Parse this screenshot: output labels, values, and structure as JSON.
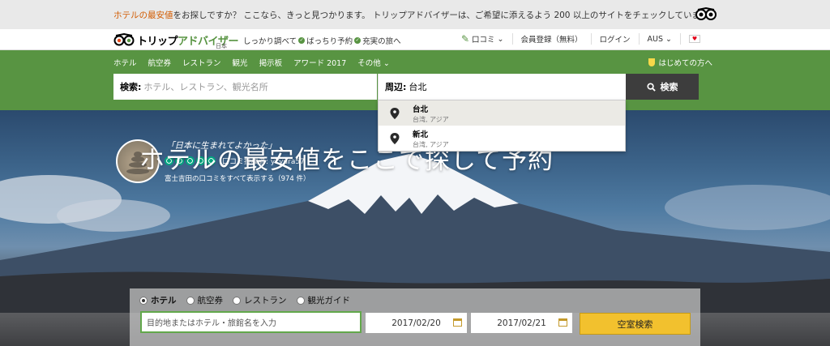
{
  "promo": {
    "highlight": "ホテルの最安値",
    "text": "をお探しですか？ ここなら、きっと見つかります。 トリップアドバイザーは、ご希望に添えるよう 200 以上のサイトをチェックしています。"
  },
  "header": {
    "brand_black": "トリップ",
    "brand_green": "アドバイザー",
    "brand_sub": "日本",
    "tagline": [
      "しっかり調べて",
      "ばっちり予約",
      "充実の旅へ"
    ],
    "review_label": "口コミ",
    "register_label": "会員登録（無料）",
    "login_label": "ログイン",
    "currency_label": "AUS"
  },
  "nav": {
    "links": [
      "ホテル",
      "航空券",
      "レストラン",
      "観光",
      "掲示板",
      "アワード 2017",
      "その他"
    ],
    "first_time": "はじめての方へ"
  },
  "search": {
    "label": "検索:",
    "placeholder": "ホテル、レストラン、観光名所",
    "near_label": "周辺:",
    "near_value": "台北",
    "button": "検索"
  },
  "suggestions": [
    {
      "name": "台北",
      "region": "台湾, アジア"
    },
    {
      "name": "新北",
      "region": "台湾, アジア"
    }
  ],
  "hero": {
    "quote": "「日本に生まれてよかった」",
    "rating": 5,
    "poster": "口コミ投稿者: ykyura57",
    "all_reviews": "富士吉田の口コミをすべて表示する（974 件）",
    "title": "ホテルの最安値をここで探して予約"
  },
  "booking": {
    "tabs": [
      "ホテル",
      "航空券",
      "レストラン",
      "観光ガイド"
    ],
    "selected_tab": 0,
    "destination_placeholder": "目的地またはホテル・旅館名を入力",
    "checkin": "2017/02/20",
    "checkout": "2017/02/21",
    "button": "空室検索"
  },
  "colors": {
    "brand_green": "#589442",
    "promo_highlight": "#d25b00",
    "search_button": "#3d3d3d",
    "book_button": "#f2c12e",
    "bubble": "#00a680"
  }
}
